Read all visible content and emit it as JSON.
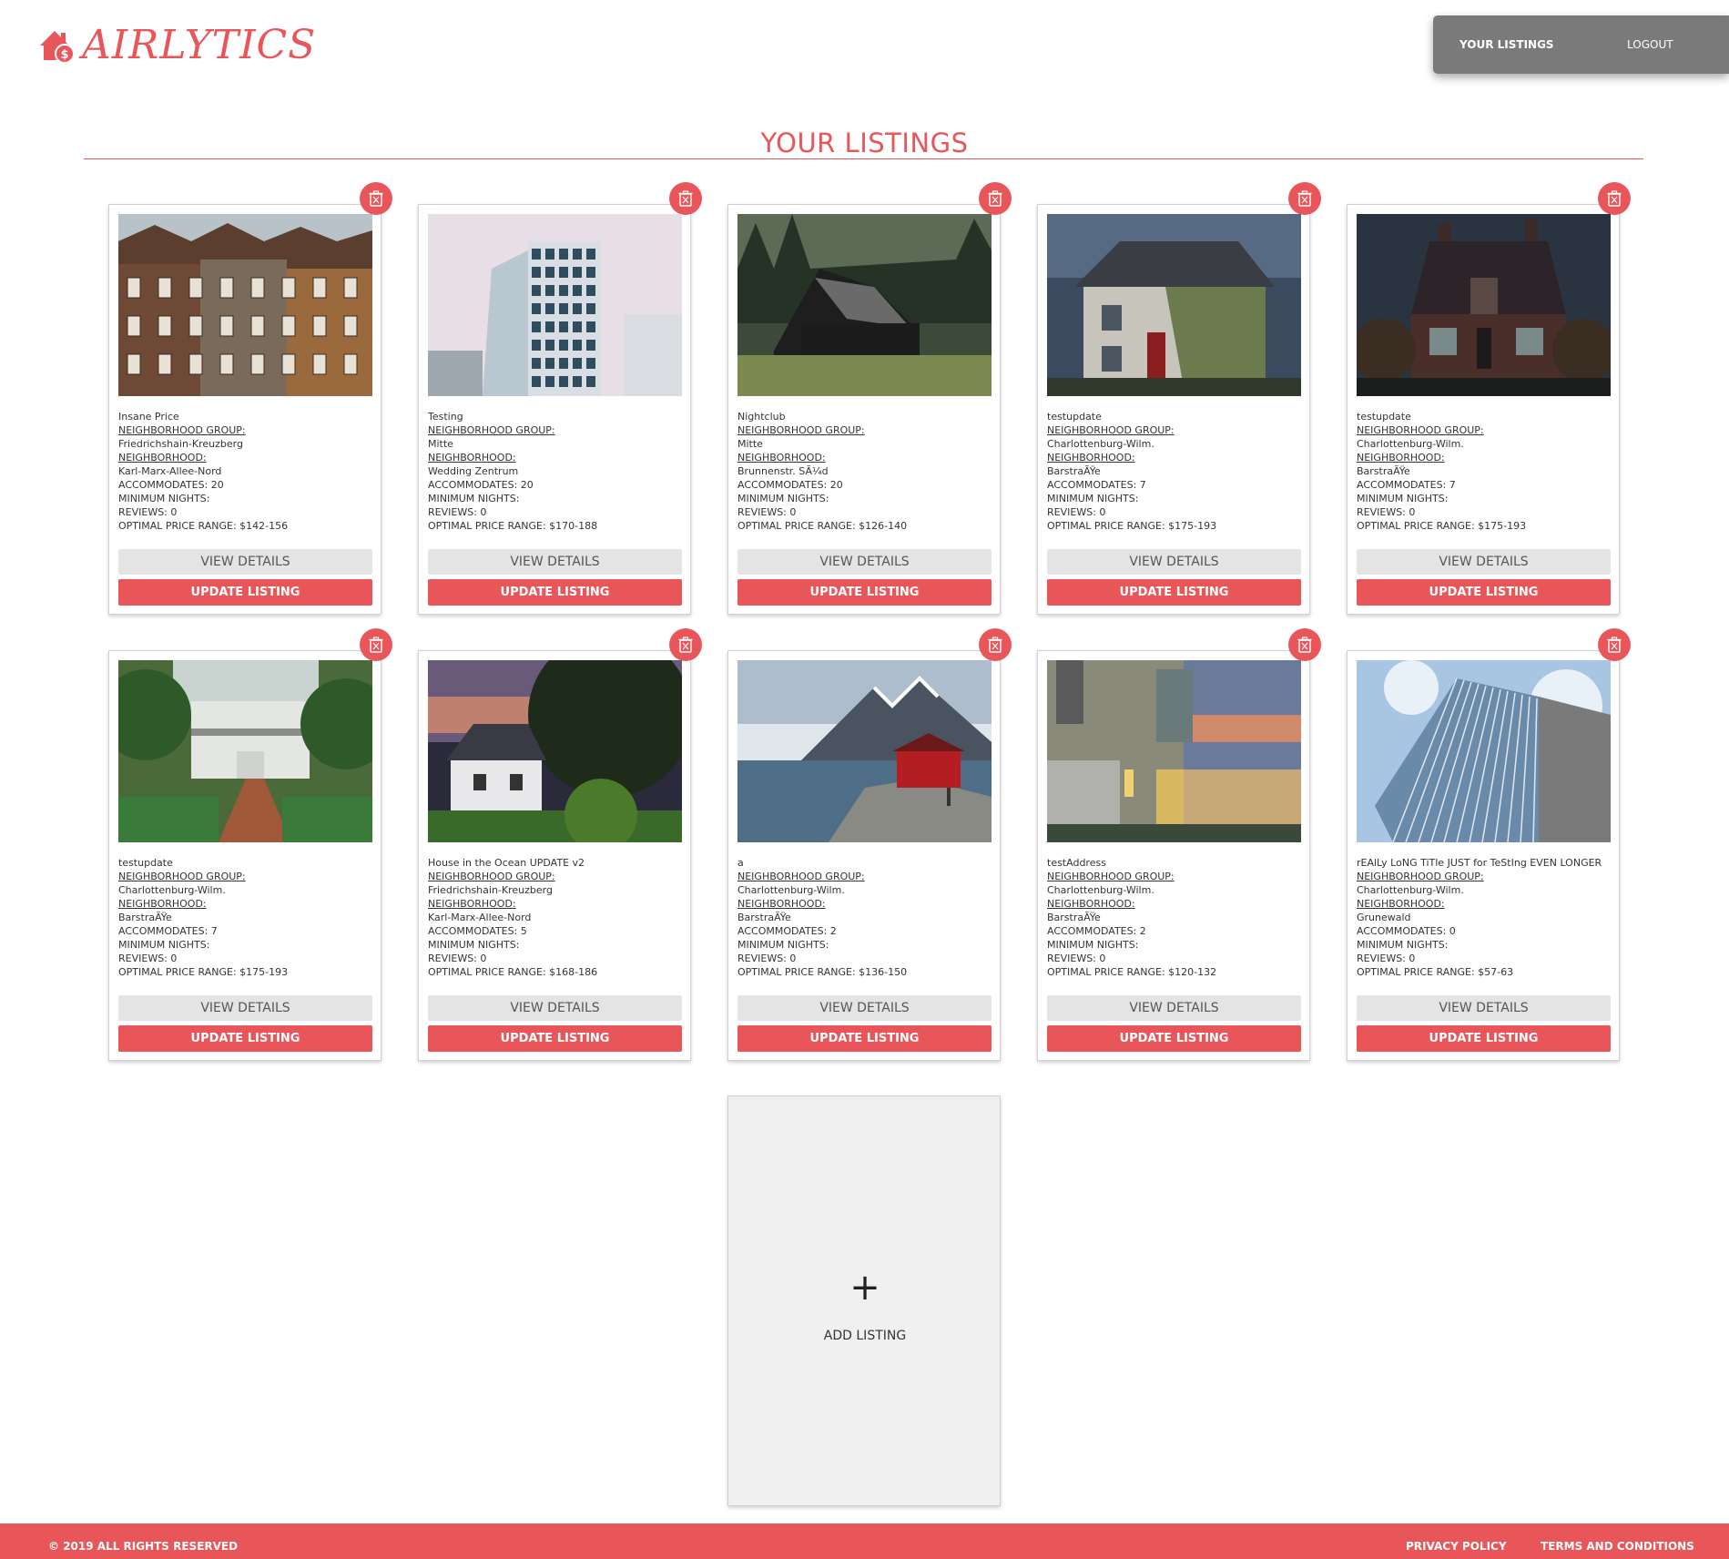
{
  "header": {
    "logo_text": "AIRLYTICS",
    "nav": {
      "your_listings": "YOUR LISTINGS",
      "logout": "LOGOUT"
    }
  },
  "page": {
    "title": "YOUR LISTINGS"
  },
  "labels": {
    "neighborhood_group": "NEIGHBORHOOD GROUP:",
    "neighborhood": "NEIGHBORHOOD:",
    "view_details": "VIEW DETAILS",
    "update_listing": "UPDATE LISTING"
  },
  "listings": [
    {
      "name": "Insane Price",
      "group": "Friedrichshain-Kreuzberg",
      "neighborhood": "Karl-Marx-Allee-Nord",
      "accommodates": "ACCOMMODATES: 20",
      "min_nights": "MINIMUM NIGHTS:",
      "reviews": "REVIEWS: 0",
      "price": "OPTIMAL PRICE RANGE: $142-156",
      "photo": "old-facades"
    },
    {
      "name": "Testing",
      "group": "Mitte",
      "neighborhood": "Wedding Zentrum",
      "accommodates": "ACCOMMODATES: 20",
      "min_nights": "MINIMUM NIGHTS:",
      "reviews": "REVIEWS: 0",
      "price": "OPTIMAL PRICE RANGE: $170-188",
      "photo": "office-tower"
    },
    {
      "name": "Nightclub",
      "group": "Mitte",
      "neighborhood": "Brunnenstr. SÃ¼d",
      "accommodates": "ACCOMMODATES: 20",
      "min_nights": "MINIMUM NIGHTS:",
      "reviews": "REVIEWS: 0",
      "price": "OPTIMAL PRICE RANGE: $126-140",
      "photo": "dark-cabin"
    },
    {
      "name": "testupdate",
      "group": "Charlottenburg-Wilm.",
      "neighborhood": "BarstraÃŸe",
      "accommodates": "ACCOMMODATES: 7",
      "min_nights": "MINIMUM NIGHTS:",
      "reviews": "REVIEWS: 0",
      "price": "OPTIMAL PRICE RANGE: $175-193",
      "photo": "ivy-house"
    },
    {
      "name": "testupdate",
      "group": "Charlottenburg-Wilm.",
      "neighborhood": "BarstraÃŸe",
      "accommodates": "ACCOMMODATES: 7",
      "min_nights": "MINIMUM NIGHTS:",
      "reviews": "REVIEWS: 0",
      "price": "OPTIMAL PRICE RANGE: $175-193",
      "photo": "brick-house"
    },
    {
      "name": "testupdate",
      "group": "Charlottenburg-Wilm.",
      "neighborhood": "BarstraÃŸe",
      "accommodates": "ACCOMMODATES: 7",
      "min_nights": "MINIMUM NIGHTS:",
      "reviews": "REVIEWS: 0",
      "price": "OPTIMAL PRICE RANGE: $175-193",
      "photo": "tropical-villa"
    },
    {
      "name": "House in the Ocean UPDATE v2",
      "group": "Friedrichshain-Kreuzberg",
      "neighborhood": "Karl-Marx-Allee-Nord",
      "accommodates": "ACCOMMODATES: 5",
      "min_nights": "MINIMUM NIGHTS:",
      "reviews": "REVIEWS: 0",
      "price": "OPTIMAL PRICE RANGE: $168-186",
      "photo": "white-cottage"
    },
    {
      "name": "a",
      "group": "Charlottenburg-Wilm.",
      "neighborhood": "BarstraÃŸe",
      "accommodates": "ACCOMMODATES: 2",
      "min_nights": "MINIMUM NIGHTS:",
      "reviews": "REVIEWS: 0",
      "price": "OPTIMAL PRICE RANGE: $136-150",
      "photo": "fjord-red-house"
    },
    {
      "name": "testAddress",
      "group": "Charlottenburg-Wilm.",
      "neighborhood": "BarstraÃŸe",
      "accommodates": "ACCOMMODATES: 2",
      "min_nights": "MINIMUM NIGHTS:",
      "reviews": "REVIEWS: 0",
      "price": "OPTIMAL PRICE RANGE: $120-132",
      "photo": "modern-house-dusk"
    },
    {
      "name": "rEAlLy LoNG TiTle JUST for TeStIng EVEN LONGER",
      "group": "Charlottenburg-Wilm.",
      "neighborhood": "Grunewald",
      "accommodates": "ACCOMMODATES: 0",
      "min_nights": "MINIMUM NIGHTS:",
      "reviews": "REVIEWS: 0",
      "price": "OPTIMAL PRICE RANGE: $57-63",
      "photo": "glass-building"
    }
  ],
  "add_card": {
    "plus": "+",
    "label": "ADD LISTING"
  },
  "footer": {
    "copyright": "© 2019 ALL RIGHTS RESERVED",
    "privacy": "PRIVACY POLICY",
    "terms": "TERMS AND CONDITIONS"
  },
  "colors": {
    "accent": "#e8565a",
    "nav_bg": "#7a7a7a",
    "button_gray": "#e4e4e4",
    "add_card_bg": "#f0f0f0"
  }
}
